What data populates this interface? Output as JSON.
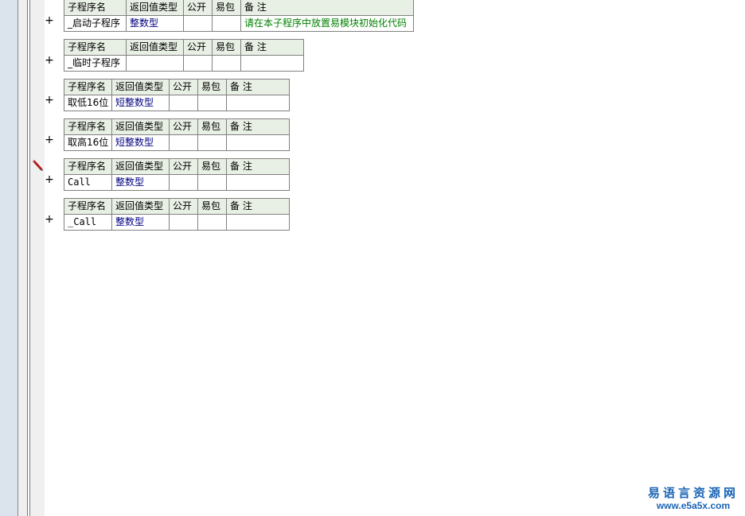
{
  "headers": {
    "name": "子程序名",
    "return_type": "返回值类型",
    "public": "公开",
    "easy_pack": "易包",
    "note": "备 注"
  },
  "subprograms": [
    {
      "name": "_启动子程序",
      "return_type": "整数型",
      "note": "请在本子程序中放置易模块初始化代码"
    },
    {
      "name": "_临时子程序",
      "return_type": "",
      "note": ""
    },
    {
      "name": "取低16位",
      "return_type": "短整数型",
      "note": ""
    },
    {
      "name": "取高16位",
      "return_type": "短整数型",
      "note": ""
    },
    {
      "name": "Call",
      "return_type": "整数型",
      "note": ""
    },
    {
      "name": "_Call",
      "return_type": "整数型",
      "note": ""
    }
  ],
  "expand_symbol": "+",
  "watermark": {
    "title": "易语言资源网",
    "url": "www.e5a5x.com"
  },
  "colors": {
    "header_bg": "#e8efe4",
    "type_text": "#000080",
    "note_text": "#008000",
    "watermark": "#1a64b4"
  }
}
